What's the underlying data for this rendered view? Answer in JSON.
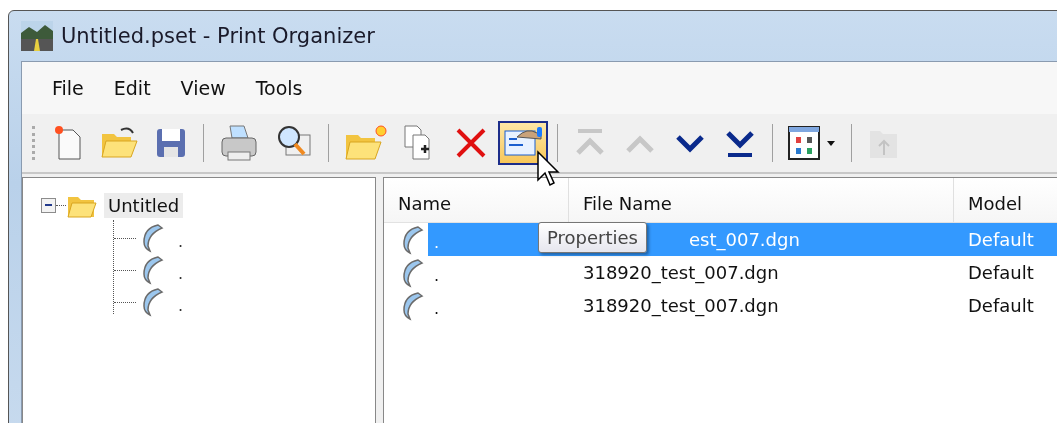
{
  "window": {
    "title": "Untitled.pset - Print Organizer"
  },
  "menu": [
    {
      "label": "File"
    },
    {
      "label": "Edit"
    },
    {
      "label": "View"
    },
    {
      "label": "Tools"
    }
  ],
  "toolbar": [
    {
      "kind": "new",
      "disabled": false,
      "selected": false
    },
    {
      "kind": "open",
      "disabled": false,
      "selected": false
    },
    {
      "kind": "save",
      "disabled": false,
      "selected": false
    },
    {
      "kind": "separator"
    },
    {
      "kind": "print",
      "disabled": false,
      "selected": false
    },
    {
      "kind": "preview",
      "disabled": false,
      "selected": false
    },
    {
      "kind": "separator"
    },
    {
      "kind": "new-folder",
      "disabled": false,
      "selected": false
    },
    {
      "kind": "add-files",
      "disabled": false,
      "selected": false
    },
    {
      "kind": "delete",
      "disabled": false,
      "selected": false
    },
    {
      "kind": "properties",
      "disabled": false,
      "selected": true
    },
    {
      "kind": "separator"
    },
    {
      "kind": "move-top",
      "disabled": true,
      "selected": false
    },
    {
      "kind": "move-up",
      "disabled": true,
      "selected": false
    },
    {
      "kind": "move-down",
      "disabled": false,
      "selected": false
    },
    {
      "kind": "move-bottom",
      "disabled": false,
      "selected": false
    },
    {
      "kind": "separator"
    },
    {
      "kind": "view-menu",
      "disabled": false,
      "selected": false
    },
    {
      "kind": "separator"
    },
    {
      "kind": "up-folder",
      "disabled": true,
      "selected": false
    }
  ],
  "tree": {
    "label": "Untitled",
    "expanded": true,
    "selected": true,
    "children": [
      {
        "label": "."
      },
      {
        "label": "."
      },
      {
        "label": "."
      }
    ]
  },
  "table": {
    "columns": [
      "Name",
      "File Name",
      "Model"
    ],
    "rows": [
      {
        "name": ".",
        "file_name": "est_007.dgn",
        "model": "Default",
        "selected": true,
        "under_tooltip": true
      },
      {
        "name": ".",
        "file_name": "318920_test_007.dgn",
        "model": "Default",
        "selected": false
      },
      {
        "name": ".",
        "file_name": "318920_test_007.dgn",
        "model": "Default",
        "selected": false
      }
    ]
  },
  "tooltip": {
    "text": "Properties"
  }
}
